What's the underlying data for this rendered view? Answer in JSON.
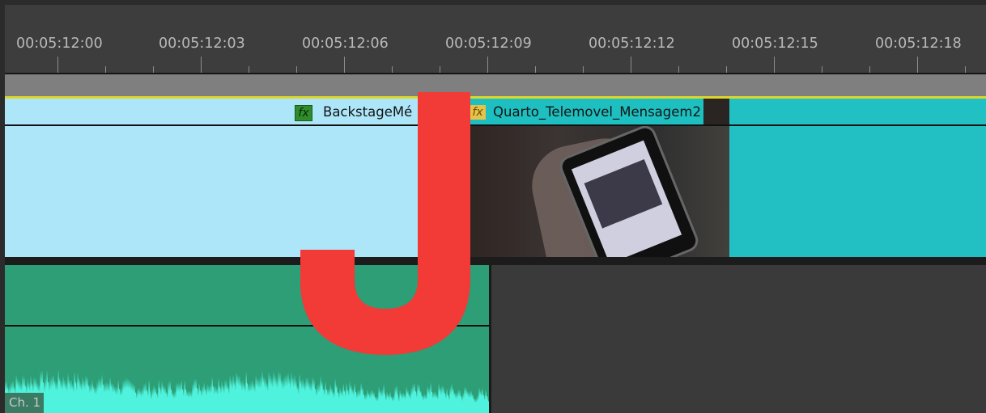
{
  "ruler": {
    "timecodes": [
      "00:05:12:00",
      "00:05:12:03",
      "00:05:12:06",
      "00:05:12:09",
      "00:05:12:12",
      "00:05:12:15",
      "00:05:12:18"
    ]
  },
  "video_track": {
    "clips": [
      {
        "name": "BackstageMé",
        "fx": "fx",
        "color": "#aee6f9"
      },
      {
        "name": "Quarto_Telemovel_Mensagem2",
        "fx": "fx",
        "color": "#1ebfc0"
      },
      {
        "name": "",
        "color": "#22c0c2"
      }
    ]
  },
  "audio_track": {
    "channel_label": "Ch. 1",
    "clip_color": "#2d9e76",
    "waveform_color": "#4ff2dc"
  },
  "overlay": {
    "letter": "J",
    "color": "#f23a37"
  },
  "colors": {
    "playhead_bar": "#dcd72b",
    "background": "#3a3a3a"
  }
}
